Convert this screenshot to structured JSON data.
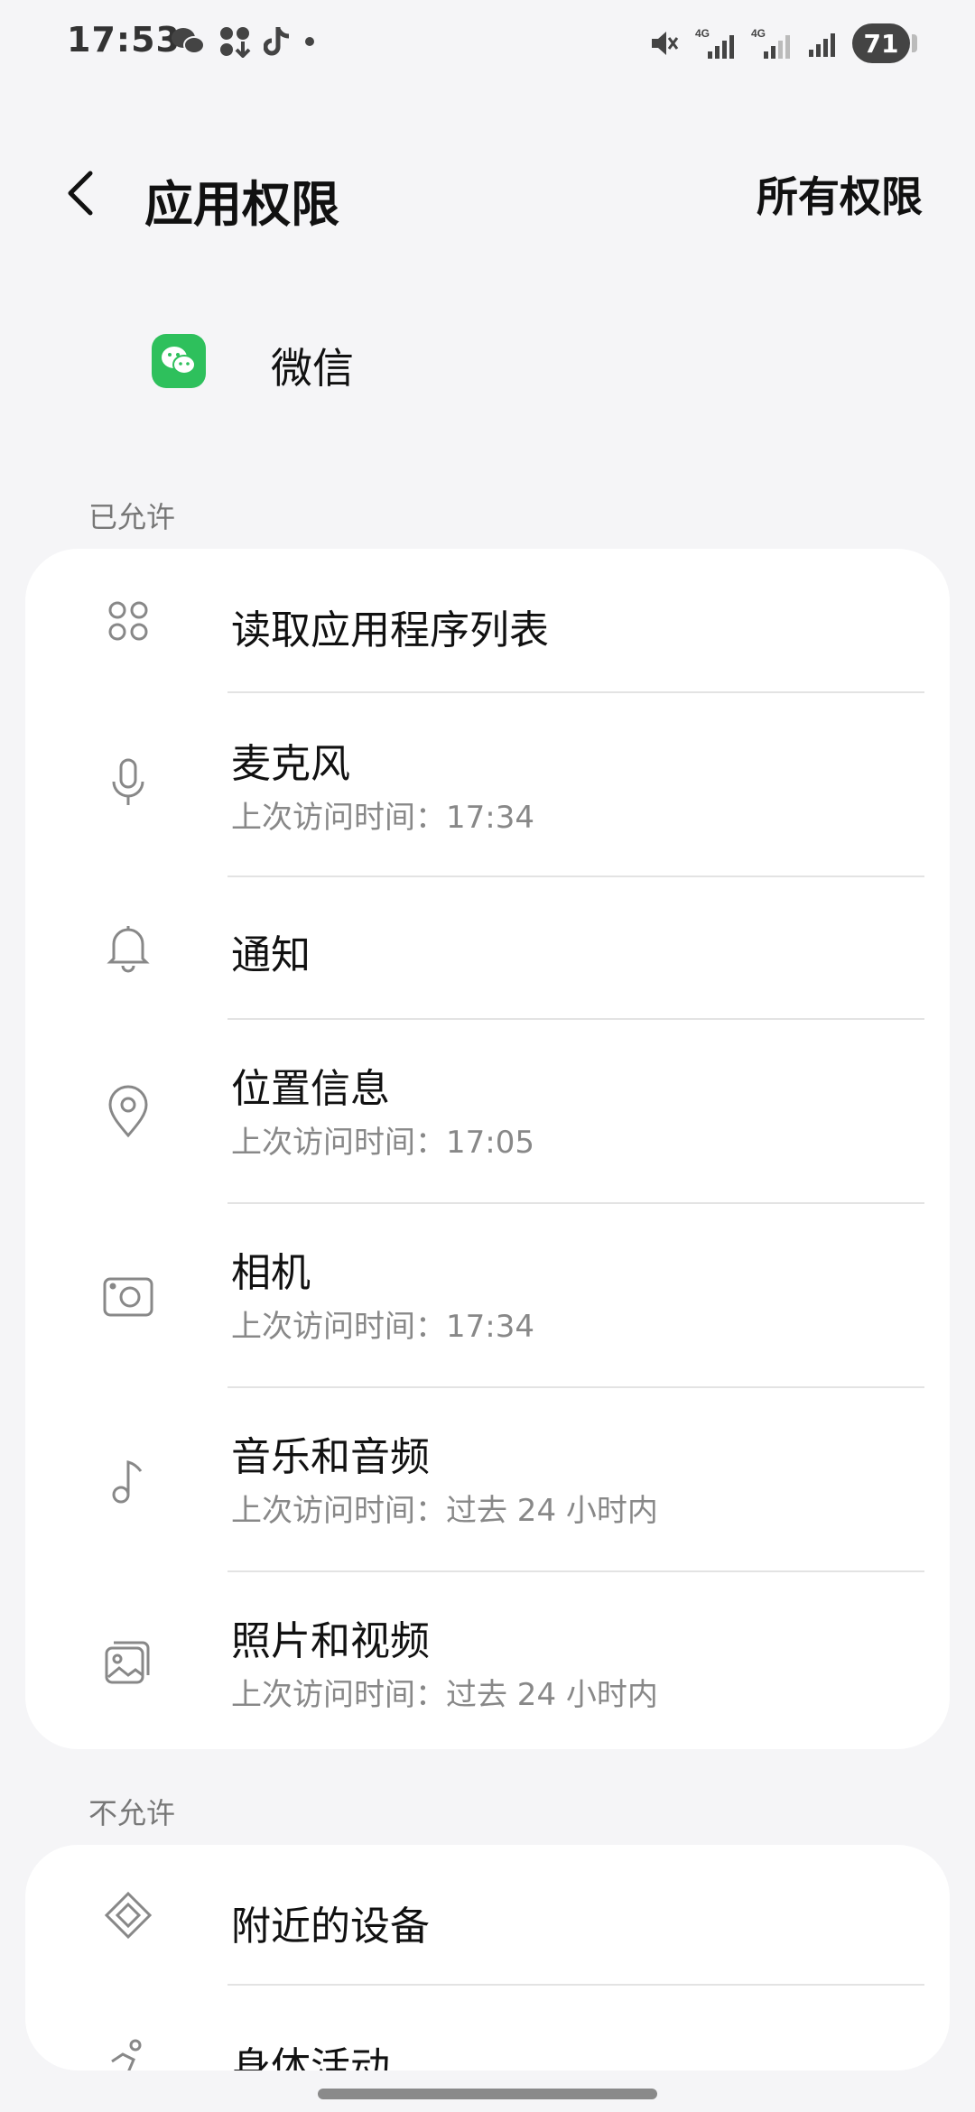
{
  "status": {
    "time": "17:53",
    "signal1": "4G",
    "signal2": "4G",
    "battery": "71"
  },
  "header": {
    "title": "应用权限",
    "action": "所有权限"
  },
  "app": {
    "name": "微信"
  },
  "allowed": {
    "label": "已允许",
    "items": [
      {
        "title": "读取应用程序列表",
        "sub": ""
      },
      {
        "title": "麦克风",
        "sub": "上次访问时间：17:34"
      },
      {
        "title": "通知",
        "sub": ""
      },
      {
        "title": "位置信息",
        "sub": "上次访问时间：17:05"
      },
      {
        "title": "相机",
        "sub": "上次访问时间：17:34"
      },
      {
        "title": "音乐和音频",
        "sub": "上次访问时间：过去 24 小时内"
      },
      {
        "title": "照片和视频",
        "sub": "上次访问时间：过去 24 小时内"
      }
    ]
  },
  "denied": {
    "label": "不允许",
    "items": [
      {
        "title": "附近的设备"
      },
      {
        "title": "身体活动"
      }
    ]
  }
}
